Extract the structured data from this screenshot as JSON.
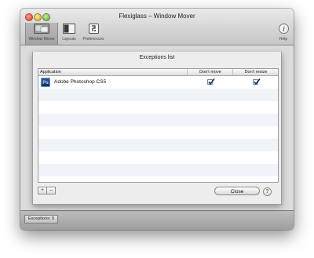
{
  "window": {
    "title": "Flexiglass – Window Mover"
  },
  "toolbar": {
    "items": [
      {
        "label": "Window Mover",
        "icon": "window-mover-icon"
      },
      {
        "label": "Layouts",
        "icon": "layouts-icon"
      },
      {
        "label": "Preferences",
        "icon": "preferences-icon"
      }
    ],
    "help_label": "Help"
  },
  "sheet": {
    "title": "Exceptions list",
    "columns": [
      "Application",
      "Don't move",
      "Don't resize"
    ],
    "rows": [
      {
        "icon_text": "Ps",
        "name": "Adobe Photoshop CS5",
        "dont_move": true,
        "dont_resize": true
      }
    ],
    "add_label": "+",
    "remove_label": "–",
    "close_label": "Close",
    "help_label": "?"
  },
  "statusbar": {
    "exceptions_label": "Exceptions: 0"
  },
  "colors": {
    "accent": "#2d5a93",
    "help_green": "#2e8b22"
  }
}
